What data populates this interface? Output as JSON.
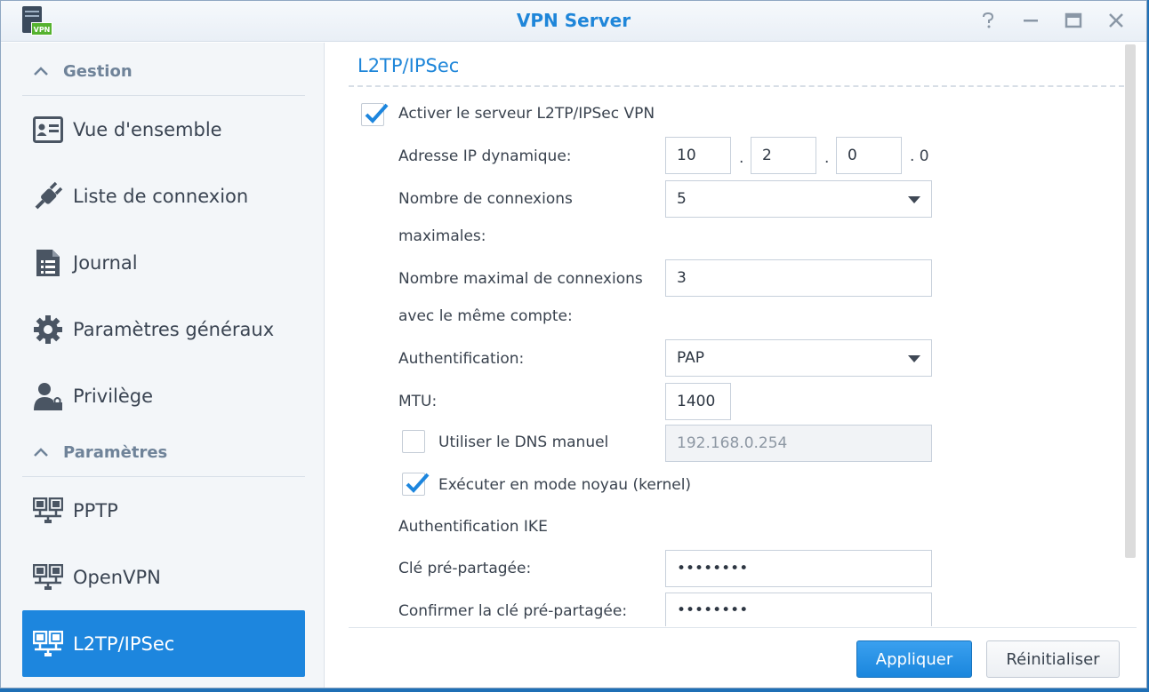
{
  "window": {
    "title": "VPN Server",
    "app_icon_badge": "VPN",
    "controls": [
      "help-icon",
      "minimize-icon",
      "maximize-icon",
      "close-icon"
    ]
  },
  "sidebar": {
    "sections": [
      {
        "label": "Gestion",
        "items": [
          {
            "label": "Vue d'ensemble",
            "icon": "overview-card-icon"
          },
          {
            "label": "Liste de connexion",
            "icon": "plug-icon"
          },
          {
            "label": "Journal",
            "icon": "log-document-icon"
          },
          {
            "label": "Paramètres généraux",
            "icon": "gear-icon"
          },
          {
            "label": "Privilège",
            "icon": "user-lock-icon"
          }
        ]
      },
      {
        "label": "Paramètres",
        "items": [
          {
            "label": "PPTP",
            "icon": "network-icon"
          },
          {
            "label": "OpenVPN",
            "icon": "network-icon"
          },
          {
            "label": "L2TP/IPSec",
            "icon": "network-icon",
            "active": true
          }
        ]
      }
    ]
  },
  "main": {
    "section_title": "L2TP/IPSec",
    "enable_label": "Activer le serveur L2TP/IPSec VPN",
    "enable_checked": true,
    "dynamic_ip": {
      "label": "Adresse IP dynamique:",
      "octets": [
        "10",
        "2",
        "0"
      ],
      "dot": ".",
      "last_octet": ". 0"
    },
    "max_connections": {
      "label_line1": "Nombre de connexions",
      "label_line2": "maximales:",
      "value": "5"
    },
    "max_same_account": {
      "label_line1": "Nombre maximal de connexions",
      "label_line2": "avec le même compte:",
      "value": "3"
    },
    "auth": {
      "label": "Authentification:",
      "value": "PAP"
    },
    "mtu": {
      "label": "MTU:",
      "value": "1400"
    },
    "manual_dns": {
      "label": "Utiliser le DNS manuel",
      "checked": false,
      "value": "192.168.0.254"
    },
    "kernel_mode": {
      "label": "Exécuter en mode noyau (kernel)",
      "checked": true
    },
    "ike_label": "Authentification IKE",
    "psk": {
      "label": "Clé pré-partagée:",
      "value": "••••••••"
    },
    "psk_confirm": {
      "label": "Confirmer la clé pré-partagée:",
      "value": "••••••••"
    },
    "buttons": {
      "apply": "Appliquer",
      "reset": "Réinitialiser"
    }
  },
  "colors": {
    "accent": "#1d86de",
    "title_text": "#1f86d9",
    "sidebar_bg": "#f3f6f9"
  }
}
